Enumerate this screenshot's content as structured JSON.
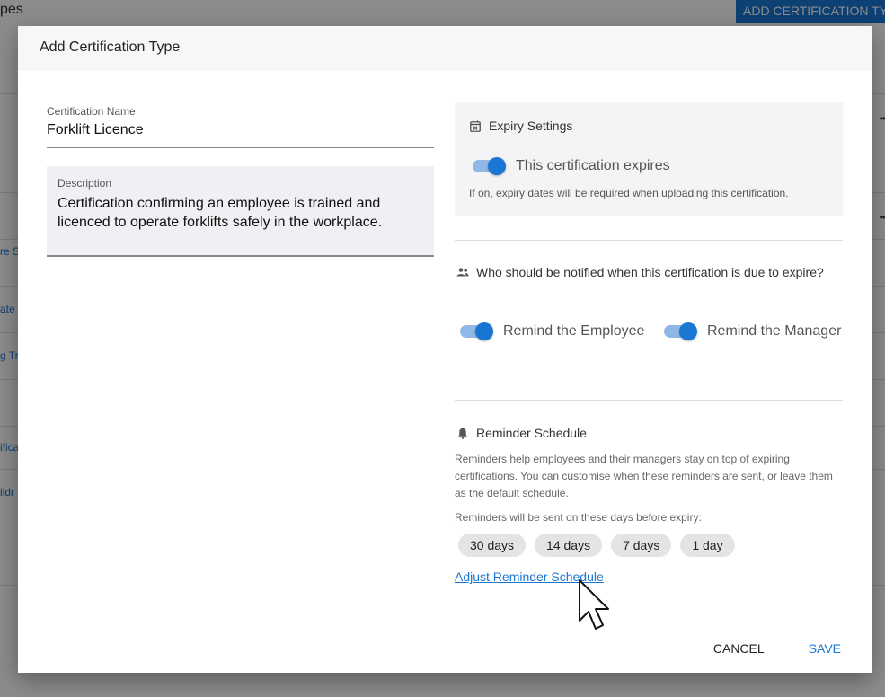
{
  "background": {
    "title": "pes",
    "add_button": "ADD CERTIFICATION TYP",
    "rows": [
      {
        "text": ""
      },
      {
        "text": ""
      },
      {
        "text": "re S"
      },
      {
        "text": "ate"
      },
      {
        "text": "g Tr"
      },
      {
        "text": ""
      },
      {
        "text": "ifica"
      },
      {
        "text": "ildr"
      }
    ],
    "row_dots": "••"
  },
  "dialog": {
    "title": "Add Certification Type",
    "name": {
      "label": "Certification Name",
      "value": "Forklift Licence"
    },
    "description": {
      "label": "Description",
      "value": "Certification confirming an employee is trained and licenced to operate forklifts safely in the workplace."
    },
    "expiry": {
      "title": "Expiry Settings",
      "toggle_label": "This certification expires",
      "toggle_on": true,
      "hint": "If on, expiry dates will be required when uploading this certification."
    },
    "notify": {
      "title": "Who should be notified when this certification is due to expire?",
      "employee_label": "Remind the Employee",
      "employee_on": true,
      "manager_label": "Remind the Manager",
      "manager_on": true
    },
    "reminders": {
      "title": "Reminder Schedule",
      "description": "Reminders help employees and their managers stay on top of expiring certifications. You can customise when these reminders are sent, or leave them as the default schedule.",
      "sub": "Reminders will be sent on these days before expiry:",
      "chips": [
        "30 days",
        "14 days",
        "7 days",
        "1 day"
      ],
      "link": "Adjust Reminder Schedule"
    },
    "actions": {
      "cancel": "CANCEL",
      "save": "SAVE"
    }
  },
  "colors": {
    "accent": "#1976d2",
    "toggle_track": "#90b8e6"
  }
}
